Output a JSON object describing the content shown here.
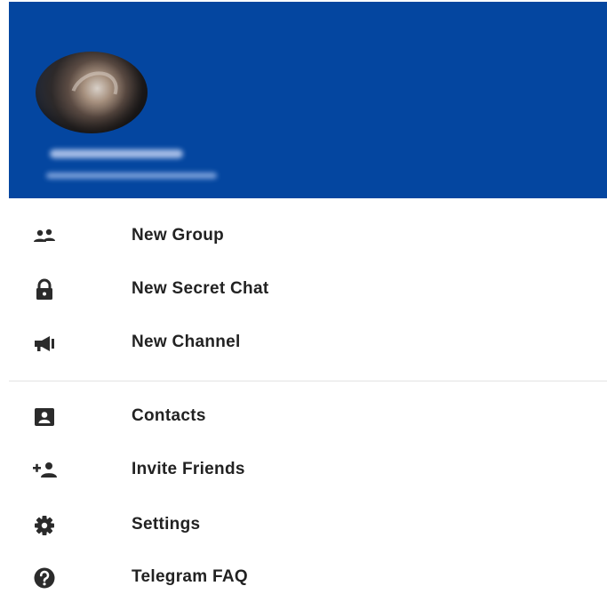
{
  "menu": {
    "items": [
      {
        "label": "New Group",
        "icon": "group-icon"
      },
      {
        "label": "New Secret Chat",
        "icon": "lock-icon"
      },
      {
        "label": "New Channel",
        "icon": "megaphone-icon"
      },
      {
        "label": "Contacts",
        "icon": "contacts-icon"
      },
      {
        "label": "Invite Friends",
        "icon": "add-person-icon"
      },
      {
        "label": "Settings",
        "icon": "gear-icon"
      },
      {
        "label": "Telegram FAQ",
        "icon": "help-icon"
      }
    ]
  },
  "colors": {
    "header_bg": "#0446a0",
    "icon": "#2b2b2b",
    "text": "#222222",
    "divider": "#e3e3e3"
  }
}
